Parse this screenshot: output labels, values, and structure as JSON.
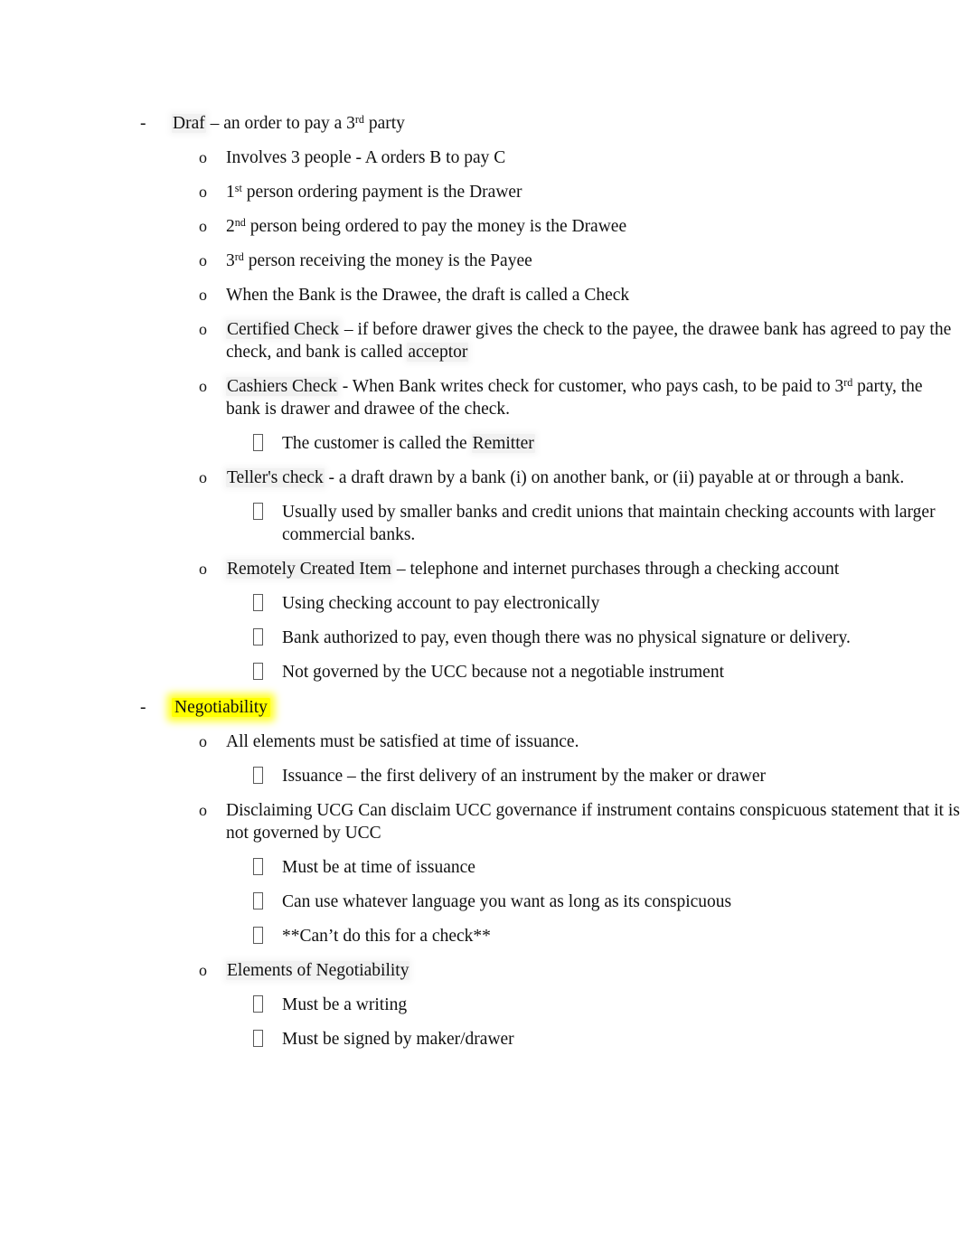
{
  "document": {
    "bullet_markers": {
      "level1": "-",
      "level2": "o",
      "level3": "box-glyph"
    },
    "colors": {
      "highlight": "#FFFF00",
      "text": "#111111",
      "page_background": "#FFFFFF",
      "shading": "#F0F0F0"
    },
    "outline": {
      "draft": {
        "term": "Draf",
        "definition": " – an order to pay a 3",
        "definition_sup": "rd",
        "definition_tail": " party",
        "involves": "Involves 3 people - A orders B to pay C",
        "first_person_num": "1",
        "first_person_sup": "st",
        "first_person": " person ordering payment is the  Drawer",
        "second_person_num": "2",
        "second_person_sup": "nd",
        "second_person": " person being ordered to pay the money is the   Drawee",
        "third_person_num": "3",
        "third_person_sup": "rd",
        "third_person": " person receiving the money is the  Payee",
        "bank_drawee": "When the Bank is the Drawee, the draft is called a  Check",
        "certified_check_term": "Certified Check",
        "certified_check_def": " – if before drawer gives the check to the payee, the drawee bank has agreed to pay the check, and bank is called ",
        "certified_check_acceptor": "acceptor",
        "cashiers_check_term": "Cashiers Check",
        "cashiers_check_def_a": " - When Bank writes check for customer, who pays cash, to be paid to 3",
        "cashiers_check_sup": "rd",
        "cashiers_check_def_b": " party, the bank is drawer and drawee of the check.",
        "remitter_line": "The customer is called the ",
        "remitter_term": "Remitter",
        "tellers_check_term": "Teller's check",
        "tellers_check_def": " - a draft drawn by a bank (i) on another bank, or (ii) payable at or through a bank.",
        "tellers_check_note": "Usually used by smaller banks and credit unions that maintain checking accounts with larger commercial banks.",
        "rci_term": "Remotely Created Item",
        "rci_def": "  – telephone and internet purchases through a checking account",
        "rci_note_1": "Using checking account to pay electronically",
        "rci_note_2": "Bank authorized to pay, even though there was no physical signature or delivery.",
        "rci_note_3": "Not governed by the UCC because not a negotiable instrument"
      },
      "negotiability": {
        "heading": "Negotiability",
        "all_elements": "All elements must be satisfied at time of issuance.",
        "issuance": "Issuance – the first delivery of an instrument by the maker  or drawer",
        "disclaiming_term": "Disclaiming UCG",
        "disclaiming_def": " Can disclaim UCC governance if instrument contains conspicuous statement that it is not governed by UCC",
        "disclaim_note_1": "Must be at time of issuance",
        "disclaim_note_2": "Can use whatever language you want as long as its conspicuous",
        "disclaim_note_3": "**Can’t do this for a check**",
        "elements_heading": "Elements of Negotiability",
        "element_1": "Must be a writing",
        "element_2": "Must be signed by maker/drawer"
      }
    }
  }
}
